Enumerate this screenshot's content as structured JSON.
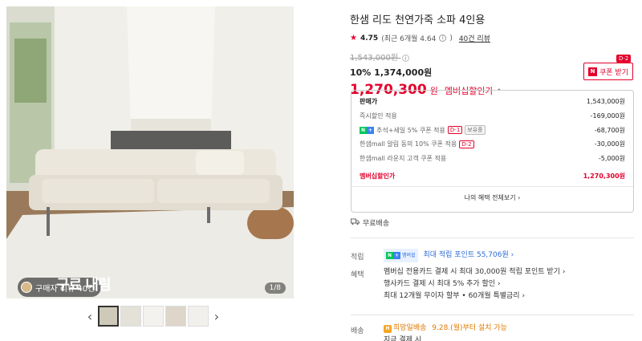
{
  "gallery": {
    "review_pill": "구매자 리뷰 40건",
    "overlay_text": "구료 내림",
    "counter": "1/8",
    "prev_arrow": "‹",
    "next_arrow": "›",
    "thumbnail_count": 5
  },
  "product": {
    "title": "한샘 리도 천연가죽 소파 4인용",
    "rating": "4.75",
    "recent_rating": "(최근 6개월 4.64",
    "review_link": "40건 리뷰",
    "original_price": "1,543,000원",
    "discount_line": "10% 1,374,000원",
    "member_price": "1,270,300",
    "member_won": "원",
    "member_label": "멤버십할인가",
    "coupon_button": "쿠폰 받기",
    "coupon_n": "N",
    "coupon_dday": "D-2"
  },
  "breakdown": {
    "rows": [
      {
        "label": "판매가",
        "value": "1,543,000원"
      },
      {
        "label": "즉시할인 적용",
        "value": "-169,000원"
      },
      {
        "label": "추석+세일 5% 쿠폰 적용",
        "tag": "D-1",
        "tag2": "보유중",
        "value": "-68,700원"
      },
      {
        "label": "한샘mall 알림 동의 10% 쿠폰 적용",
        "tag": "D-2",
        "value": "-30,000원"
      },
      {
        "label": "한샘mall 라운지 고객 쿠폰 적용",
        "value": "-5,000원"
      }
    ],
    "total_label": "멤버십할인가",
    "total_value": "1,270,300원",
    "more": "나의 혜택 전체보기 ›"
  },
  "shipping": {
    "label": "무료배송"
  },
  "points": {
    "label": "적립",
    "badge": "멤버쉽",
    "text": "최대 적립 포인트 55,706원 ›"
  },
  "benefits": {
    "label": "혜택",
    "lines": [
      "멤버십 전용카드 결제 시 최대 30,000원 적립 포인트 받기 ›",
      "행사카드 결제 시 최대 5% 추가 할인 ›",
      "최대 12개월 무이자 할부 • 60개월 특별금리 ›"
    ]
  },
  "delivery": {
    "label": "배송",
    "badge": "희망일배송",
    "date": "9.28.(월)부터 설치 가능",
    "sub": "지금 결제 시"
  },
  "colors": {
    "accent": "#e3002b",
    "point": "#2b6bd6",
    "delivery": "#e07a00"
  }
}
